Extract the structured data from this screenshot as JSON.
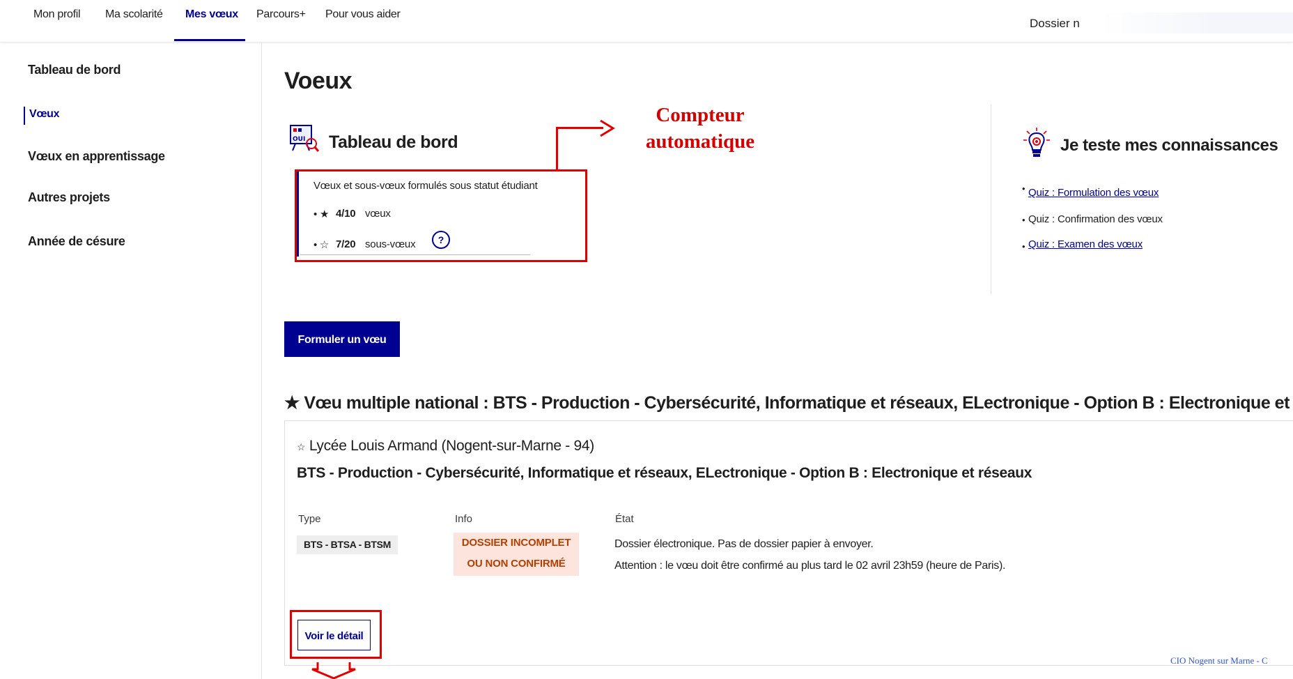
{
  "topnav": {
    "items": [
      "Mon profil",
      "Ma scolarité",
      "Mes vœux",
      "Parcours+",
      "Pour vous aider"
    ],
    "active": "Mes vœux",
    "dossier_label": "Dossier n"
  },
  "sidebar": {
    "items": [
      {
        "label": "Tableau de bord"
      },
      {
        "label": "Vœux"
      },
      {
        "label": "Vœux en apprentissage"
      },
      {
        "label": "Autres projets"
      },
      {
        "label": "Année de césure"
      }
    ],
    "active": "Vœux"
  },
  "main": {
    "title": "Voeux",
    "dashboard": {
      "title": "Tableau de bord",
      "icon": "board-icon",
      "heading": "Vœux et sous-vœux formulés sous statut étudiant",
      "voeux_count": "4/10",
      "voeux_unit": "vœux",
      "sousvoeux_count": "7/20",
      "sousvoeux_unit": "sous-vœux",
      "help_glyph": "?"
    },
    "annotation": {
      "line1": "Compteur",
      "line2": "automatique",
      "color": "#e00000"
    },
    "quiz": {
      "title": "Je teste mes connaissances",
      "icon": "lightbulb-icon",
      "links": [
        "Quiz : Formulation des vœux",
        "Quiz : Confirmation des vœux",
        "Quiz : Examen des vœux"
      ]
    },
    "formuler_button": "Formuler un vœu",
    "voeu": {
      "title": "Vœu multiple national : BTS - Production - Cybersécurité, Informatique et réseaux, ELectronique - Option B : Electronique et réseaux",
      "etablissement": "Lycée Louis Armand",
      "lieu": "(Nogent-sur-Marne - 94)",
      "formation": "BTS - Production - Cybersécurité, Informatique et réseaux, ELectronique - Option B : Electronique et réseaux",
      "headers": {
        "type": "Type",
        "info": "Info",
        "etat": "État"
      },
      "type_value": "BTS - BTSA - BTSM",
      "info_line1": "DOSSIER INCOMPLET",
      "info_line2": "OU NON CONFIRMÉ",
      "etat_line1": "Dossier électronique. Pas de dossier papier à envoyer.",
      "etat_line2": "Attention : le vœu doit être confirmé au plus tard le 02 avril 23h59 (heure de Paris).",
      "detail_button": "Voir le détail"
    },
    "footer_note": "CIO Nogent sur Marne - C"
  },
  "colors": {
    "primary": "#000091",
    "annotation_red": "#e00000",
    "warning_bg": "#fde5dd",
    "warning_text": "#b34000"
  }
}
